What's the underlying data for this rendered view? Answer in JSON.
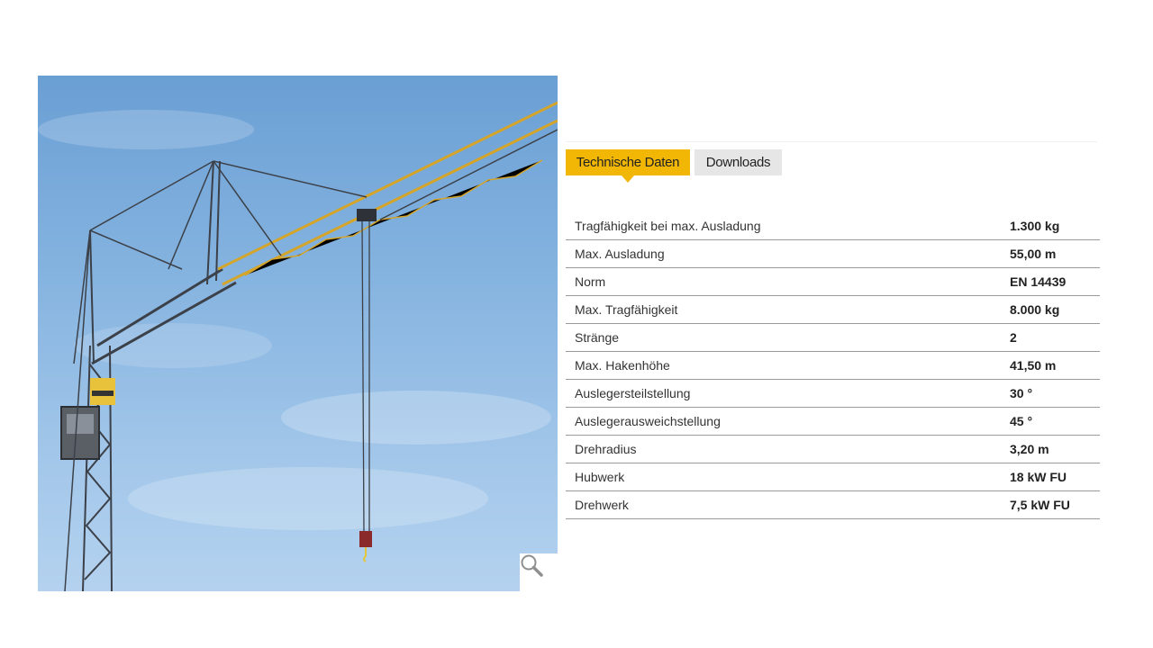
{
  "tabs": {
    "active_label": "Technische Daten",
    "inactive_label": "Downloads"
  },
  "specs": [
    {
      "label": "Tragfähigkeit bei max. Ausladung",
      "value": "1.300 kg"
    },
    {
      "label": "Max. Ausladung",
      "value": "55,00 m"
    },
    {
      "label": "Norm",
      "value": "EN 14439"
    },
    {
      "label": "Max. Tragfähigkeit",
      "value": "8.000 kg"
    },
    {
      "label": "Stränge",
      "value": "2"
    },
    {
      "label": "Max. Hakenhöhe",
      "value": "41,50 m"
    },
    {
      "label": "Auslegersteilstellung",
      "value": "30 °"
    },
    {
      "label": "Auslegerausweichstellung",
      "value": "45 °"
    },
    {
      "label": "Drehradius",
      "value": "3,20 m"
    },
    {
      "label": "Hubwerk",
      "value": "18 kW FU"
    },
    {
      "label": "Drehwerk",
      "value": "7,5 kW FU"
    }
  ],
  "image": {
    "zoom_icon": "magnifier-icon"
  },
  "colors": {
    "accent": "#f2b705",
    "tab_inactive": "#e6e6e6",
    "row_border": "#9a9a9a"
  }
}
